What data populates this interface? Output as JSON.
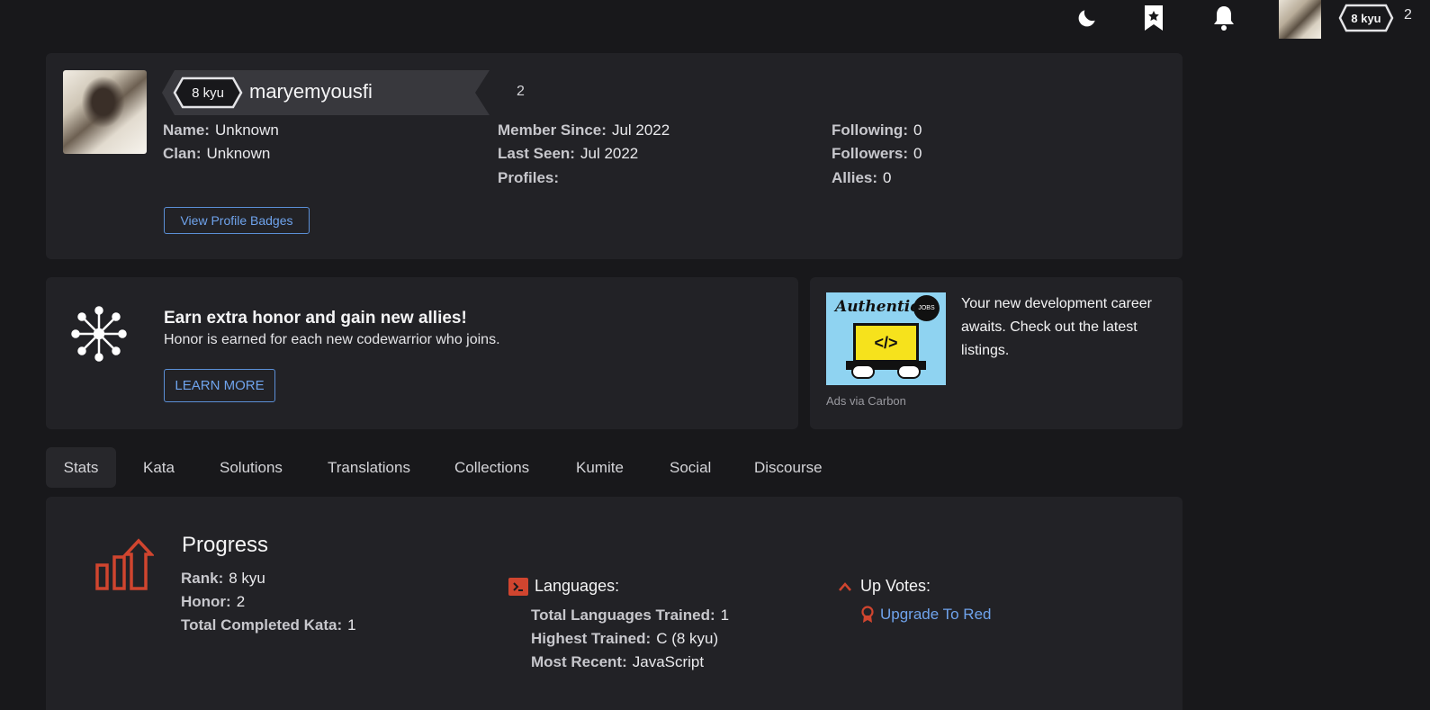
{
  "nav": {
    "theme_icon": "moon-icon",
    "bookmark_icon": "bookmark-star-icon",
    "notification_icon": "bell-icon",
    "rank": "8 kyu",
    "honor": "2"
  },
  "profile": {
    "rank": "8 kyu",
    "username": "maryemyousfi",
    "honor": "2",
    "fields": {
      "name_label": "Name:",
      "name_value": "Unknown",
      "clan_label": "Clan:",
      "clan_value": "Unknown",
      "member_since_label": "Member Since:",
      "member_since_value": "Jul 2022",
      "last_seen_label": "Last Seen:",
      "last_seen_value": "Jul 2022",
      "profiles_label": "Profiles:",
      "following_label": "Following:",
      "following_value": "0",
      "followers_label": "Followers:",
      "followers_value": "0",
      "allies_label": "Allies:",
      "allies_value": "0"
    },
    "badges_button": "View Profile Badges"
  },
  "promo": {
    "title": "Earn extra honor and gain new allies!",
    "subtitle": "Honor is earned for each new codewarrior who joins.",
    "button": "LEARN MORE"
  },
  "ad": {
    "image_brand": "Authentic",
    "image_badge": "JOBS",
    "image_code": "</>",
    "text": "Your new development career awaits. Check out the latest listings.",
    "via": "Ads via Carbon"
  },
  "tabs": [
    "Stats",
    "Kata",
    "Solutions",
    "Translations",
    "Collections",
    "Kumite",
    "Social",
    "Discourse"
  ],
  "stats": {
    "progress_title": "Progress",
    "rank_label": "Rank:",
    "rank_value": "8 kyu",
    "honor_label": "Honor:",
    "honor_value": "2",
    "completed_label": "Total Completed Kata:",
    "completed_value": "1",
    "languages_title": "Languages:",
    "total_lang_label": "Total Languages Trained:",
    "total_lang_value": "1",
    "highest_label": "Highest Trained:",
    "highest_value": "C (8 kyu)",
    "recent_label": "Most Recent:",
    "recent_value": "JavaScript",
    "upvotes_title": "Up Votes:",
    "upgrade_link": "Upgrade To Red"
  },
  "colors": {
    "background": "#18181b",
    "card": "#222226",
    "accent_blue": "#6fa3ec",
    "accent_red": "#d0452f"
  }
}
